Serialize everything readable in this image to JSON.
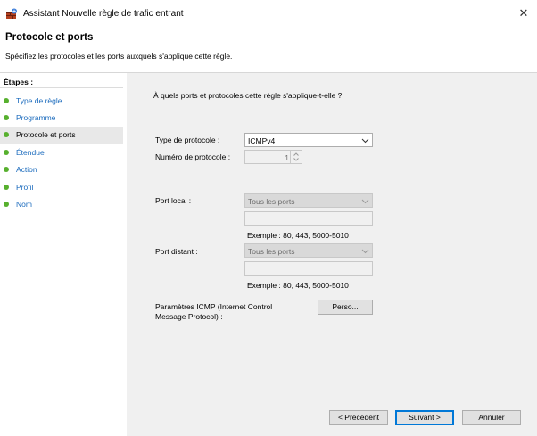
{
  "window": {
    "title": "Assistant Nouvelle règle de trafic entrant",
    "close_glyph": "✕"
  },
  "header": {
    "title": "Protocole et ports",
    "description": "Spécifiez les protocoles et les ports auxquels s'applique cette règle."
  },
  "sidebar": {
    "heading": "Étapes :",
    "items": [
      {
        "label": "Type de règle",
        "active": false
      },
      {
        "label": "Programme",
        "active": false
      },
      {
        "label": "Protocole et ports",
        "active": true
      },
      {
        "label": "Étendue",
        "active": false
      },
      {
        "label": "Action",
        "active": false
      },
      {
        "label": "Profil",
        "active": false
      },
      {
        "label": "Nom",
        "active": false
      }
    ],
    "dot_color": "#57b02e"
  },
  "main": {
    "question": "À quels ports et protocoles cette règle s'applique-t-elle ?",
    "protocol_type": {
      "label": "Type de protocole :",
      "value": "ICMPv4"
    },
    "protocol_number": {
      "label": "Numéro de protocole :",
      "value": "1"
    },
    "local_port": {
      "label": "Port local :",
      "value": "Tous les ports",
      "text_value": "",
      "example": "Exemple : 80, 443, 5000-5010"
    },
    "remote_port": {
      "label": "Port distant :",
      "value": "Tous les ports",
      "text_value": "",
      "example": "Exemple : 80, 443, 5000-5010"
    },
    "icmp": {
      "label_line1": "Paramètres ICMP (Internet Control",
      "label_line2": "Message Protocol) :",
      "button": "Perso..."
    }
  },
  "footer": {
    "back": "< Précédent",
    "next": "Suivant >",
    "cancel": "Annuler"
  },
  "colors": {
    "accent": "#0078d7",
    "link": "#1b6bbd",
    "panel_bg": "#f0f0f0"
  }
}
